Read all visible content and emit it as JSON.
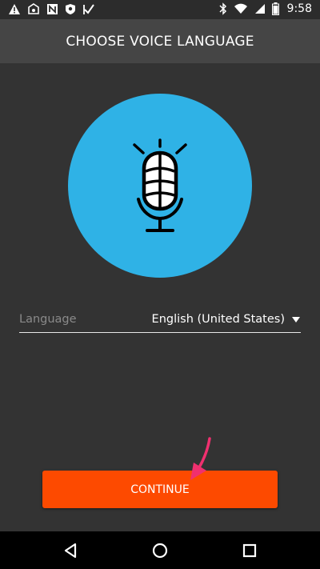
{
  "status_bar": {
    "time": "9:58",
    "left_icons": [
      "warning-icon",
      "eye-shield-icon",
      "n-icon",
      "shield-icon",
      "check-flag-icon"
    ],
    "right_icons": [
      "bluetooth-icon",
      "wifi-icon",
      "signal-icon",
      "battery-icon"
    ]
  },
  "header": {
    "title": "CHOOSE VOICE LANGUAGE",
    "background": "#454545"
  },
  "hero": {
    "icon": "microphone-icon",
    "circle_color": "#2fb2e6"
  },
  "language_field": {
    "label": "Language",
    "value": "English (United States)",
    "icon": "dropdown-arrow-icon"
  },
  "continue_button": {
    "label": "CONTINUE",
    "color": "#fd4a00"
  },
  "annotation": {
    "icon": "pink-pointer-arrow",
    "color": "#f0306f"
  },
  "nav_bar": {
    "items": [
      "back-icon",
      "home-icon",
      "recents-icon"
    ]
  }
}
